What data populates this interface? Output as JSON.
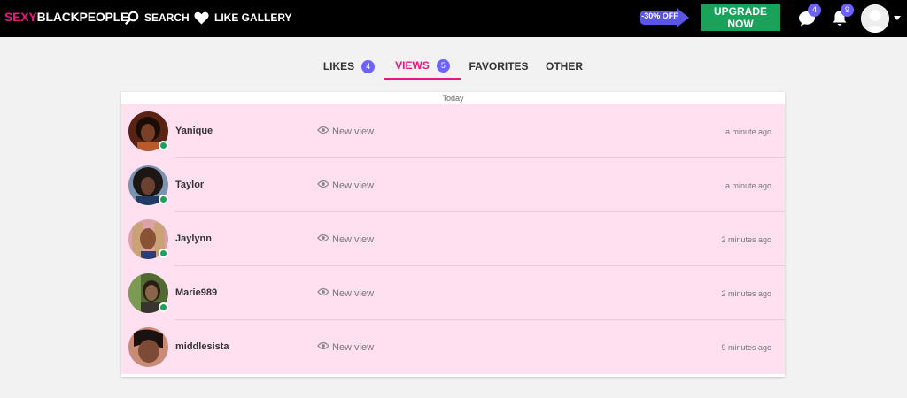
{
  "header": {
    "logo_part1": "SEXY",
    "logo_part2": "BLACKPEOPLE",
    "search_label": "SEARCH",
    "like_gallery_label": "LIKE GALLERY",
    "promo_label": "-30% OFF",
    "upgrade_label": "UPGRADE NOW",
    "messages_count": "4",
    "notifications_count": "9"
  },
  "tabs": [
    {
      "label": "LIKES",
      "badge": "4"
    },
    {
      "label": "VIEWS",
      "badge": "5"
    },
    {
      "label": "FAVORITES"
    },
    {
      "label": "OTHER"
    }
  ],
  "list": {
    "date_header": "Today",
    "items": [
      {
        "name": "Yanique",
        "action": "New view",
        "time": "a minute ago",
        "online": true
      },
      {
        "name": "Taylor",
        "action": "New view",
        "time": "a minute ago",
        "online": true
      },
      {
        "name": "Jaylynn",
        "action": "New view",
        "time": "2 minutes ago",
        "online": true
      },
      {
        "name": "Marie989",
        "action": "New view",
        "time": "2 minutes ago",
        "online": true
      },
      {
        "name": "middlesista",
        "action": "New view",
        "time": "9 minutes ago",
        "online": false
      }
    ]
  },
  "colors": {
    "brand_pink": "#e8197d",
    "upgrade_green": "#1aa15a",
    "badge_purple": "#6c63ff",
    "row_pink": "#ffe0f1"
  },
  "icons": {
    "search": "search-icon",
    "like_gallery": "heart-icon",
    "messages": "chat-bubble-icon",
    "notifications": "bell-icon",
    "view": "eye-icon"
  }
}
